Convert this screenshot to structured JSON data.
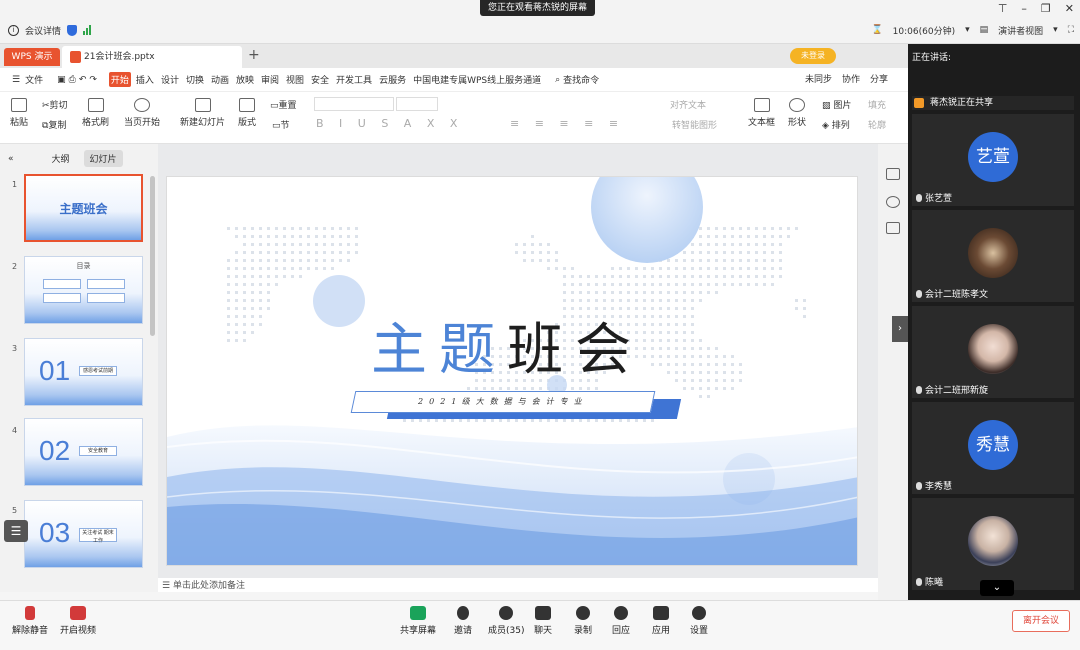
{
  "meeting": {
    "share_banner": "您正在观看蒋杰锐的屏幕",
    "info_label": "会议详情",
    "time": "10:06(60分钟)",
    "view_mode": "演讲者视图"
  },
  "wps": {
    "app_tab": "WPS 演示",
    "doc_tab": "21会计班会.pptx",
    "login": "未登录",
    "menu": [
      "文件",
      "开始",
      "插入",
      "设计",
      "切换",
      "动画",
      "放映",
      "审阅",
      "视图",
      "安全",
      "开发工具",
      "云服务",
      "中国电建专属WPS线上服务通道"
    ],
    "active_menu": "开始",
    "search": "查找命令",
    "menu_right": [
      "未同步",
      "协作",
      "分享"
    ],
    "ribbon": {
      "paste": "粘贴",
      "cut": "剪切",
      "copy": "复制",
      "format_painter": "格式刷",
      "play_current": "当页开始",
      "new_slide": "新建幻灯片",
      "layout": "版式",
      "section": "节",
      "reset": "重置",
      "textbox": "文本框",
      "shape": "形状",
      "picture": "图片",
      "arrange": "排列",
      "fill": "填充",
      "outline": "轮廓",
      "align_text": "对齐文本",
      "smart": "转智能图形"
    }
  },
  "panel": {
    "tab_outline": "大纲",
    "tab_slides": "幻灯片",
    "thumbs": [
      {
        "num": "1",
        "title": "主题班会"
      },
      {
        "num": "2",
        "title": "目录"
      },
      {
        "num": "3",
        "big": "01",
        "pill": "感恩考试前期"
      },
      {
        "num": "4",
        "big": "02",
        "pill": "安全教育"
      },
      {
        "num": "5",
        "big": "03",
        "pill": "关注考试 期末工作"
      }
    ]
  },
  "slide": {
    "title_blue": "主题",
    "title_dark": "班会",
    "subtitle": "2021级大数据与会计专业"
  },
  "notes_placeholder": "单击此处添加备注",
  "participants": {
    "speaking_label": "正在讲话:",
    "sharing": "蒋杰锐正在共享",
    "tiles": [
      {
        "name": "张艺萱",
        "avatar_text": "艺萱"
      },
      {
        "name": "会计二班陈孝文"
      },
      {
        "name": "会计二班邢新旋"
      },
      {
        "name": "李秀慧",
        "avatar_text": "秀慧"
      },
      {
        "name": "陈曦"
      }
    ]
  },
  "toolbar": {
    "unmute": "解除静音",
    "video": "开启视频",
    "share": "共享屏幕",
    "invite": "邀请",
    "members": "成员(35)",
    "chat": "聊天",
    "record": "录制",
    "reactions": "回应",
    "apps": "应用",
    "settings": "设置",
    "leave": "离开会议"
  },
  "colors": {
    "accent": "#e8532f",
    "slide_blue": "#4d84d6",
    "meeting_blue": "#2f6bd6"
  }
}
